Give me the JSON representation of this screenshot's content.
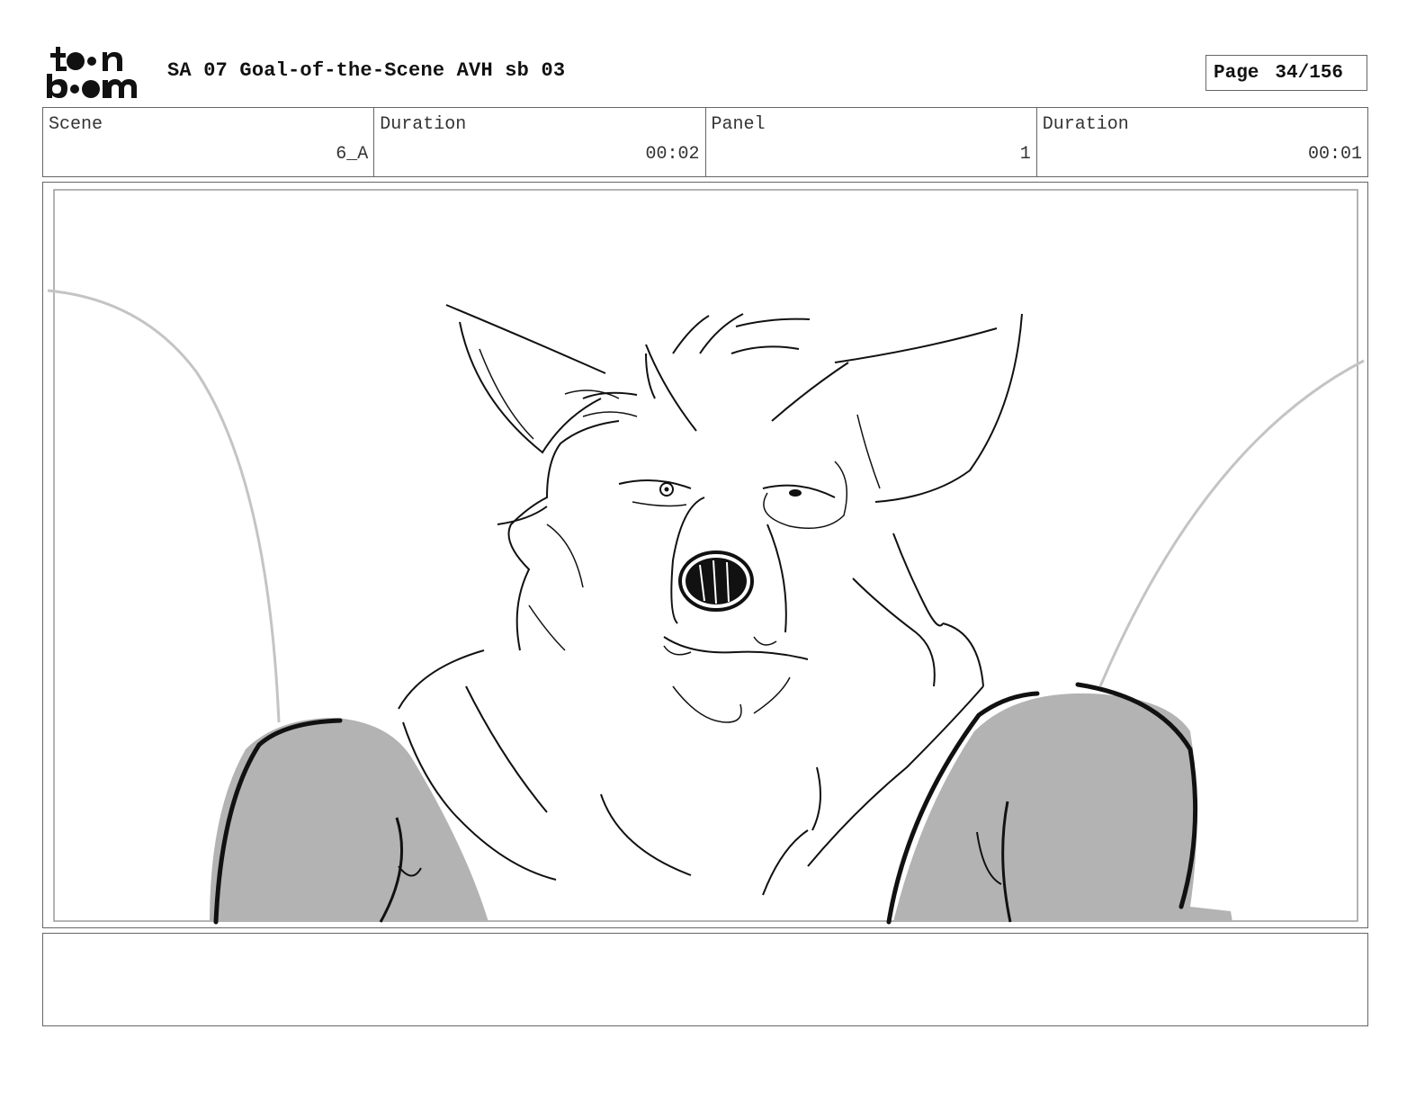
{
  "header": {
    "logo_text": "toon boom",
    "title": "SA 07 Goal-of-the-Scene AVH sb 03",
    "page_label": "Page",
    "page_value": "34/156"
  },
  "info": {
    "scene_label": "Scene",
    "scene_value": "6_A",
    "duration_label": "Duration",
    "duration_value": "00:02",
    "panel_label": "Panel",
    "panel_value": "1",
    "panel_duration_label": "Duration",
    "panel_duration_value": "00:01"
  },
  "panel": {
    "image_description_icon": "storyboard-sketch-wolf-character",
    "fill_color": "#b3b3b3",
    "line_color": "#111111"
  },
  "notes": {
    "text": ""
  }
}
